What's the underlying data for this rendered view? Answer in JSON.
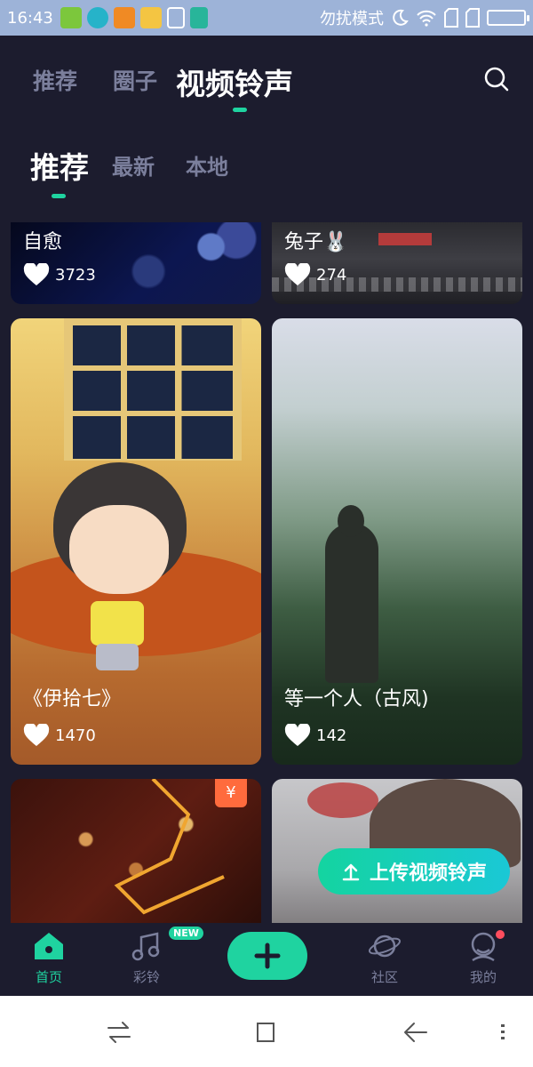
{
  "status_bar": {
    "time": "16:43",
    "dnd_text": "勿扰模式",
    "icons": [
      "app-icon-green",
      "app-icon-cyan",
      "warning-icon",
      "folder-icon",
      "brush-icon",
      "usb-icon",
      "moon-icon",
      "wifi-icon",
      "sim-icon",
      "sim-icon",
      "battery-icon"
    ]
  },
  "top_nav": {
    "tabs": [
      {
        "label": "推荐",
        "active": false
      },
      {
        "label": "圈子",
        "active": false
      },
      {
        "label": "视频铃声",
        "active": true
      }
    ],
    "search_icon": "search-icon"
  },
  "sub_nav": {
    "tabs": [
      {
        "label": "推荐",
        "active": true
      },
      {
        "label": "最新",
        "active": false
      },
      {
        "label": "本地",
        "active": false
      }
    ]
  },
  "cards": [
    {
      "title": "自愈",
      "likes": "3723"
    },
    {
      "title": "兔子🐰",
      "likes": "274"
    },
    {
      "title": "《伊拾七》",
      "likes": "1470"
    },
    {
      "title": "等一个人（古风)",
      "likes": "142"
    },
    {
      "price_badge": "¥"
    }
  ],
  "upload_button": {
    "label": "上传视频铃声"
  },
  "bottom_nav": {
    "items": [
      {
        "label": "首页",
        "icon": "home-icon",
        "active": true
      },
      {
        "label": "彩铃",
        "icon": "music-note-icon",
        "badge": "NEW"
      },
      {
        "label": "",
        "icon": "plus-icon"
      },
      {
        "label": "社区",
        "icon": "planet-icon"
      },
      {
        "label": "我的",
        "icon": "user-icon"
      }
    ]
  },
  "colors": {
    "accent": "#1fd3a0",
    "background": "#1c1c2e",
    "inactive_text": "#7b7f9c",
    "status_bar": "#9db3d8"
  }
}
